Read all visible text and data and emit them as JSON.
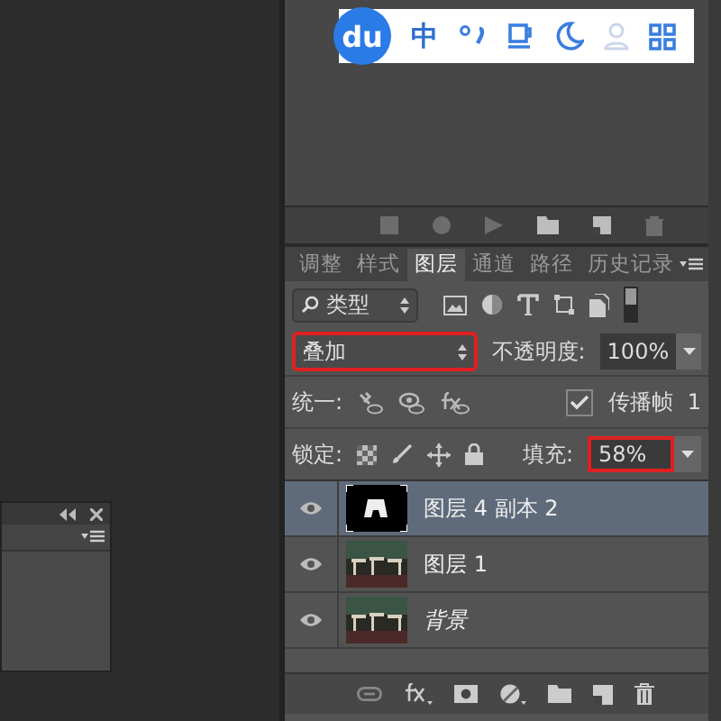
{
  "ime_toolbar": {
    "logo": "du",
    "mode": "中"
  },
  "tabs": [
    {
      "label": "调整",
      "selected": false
    },
    {
      "label": "样式",
      "selected": false
    },
    {
      "label": "图层",
      "selected": true
    },
    {
      "label": "通道",
      "selected": false
    },
    {
      "label": "路径",
      "selected": false
    },
    {
      "label": "历史记录",
      "selected": false
    }
  ],
  "filter": {
    "value": "类型"
  },
  "blend_mode": {
    "value": "叠加",
    "highlighted": true
  },
  "opacity": {
    "label": "不透明度:",
    "value": "100%"
  },
  "unify": {
    "label": "统一:"
  },
  "propagate": {
    "label": "传播帧",
    "checked": true,
    "value": "1"
  },
  "lock": {
    "label": "锁定:"
  },
  "fill": {
    "label": "填充:",
    "value": "58%",
    "highlighted": true
  },
  "layers": [
    {
      "name": "图层 4 副本 2",
      "kind": "mask",
      "visible": true,
      "selected": true
    },
    {
      "name": "图层 1",
      "kind": "layer",
      "visible": true,
      "selected": false
    },
    {
      "name": "背景",
      "kind": "background",
      "visible": true,
      "selected": false
    }
  ]
}
